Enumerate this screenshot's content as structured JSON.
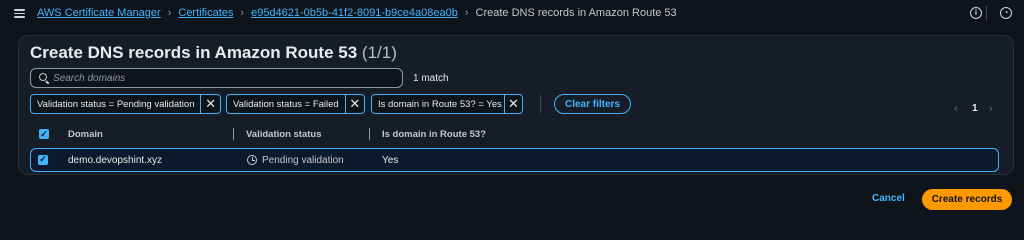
{
  "breadcrumbs": {
    "items": [
      "AWS Certificate Manager",
      "Certificates",
      "e95d4621-0b5b-41f2-8091-b9ce4a08ea0b"
    ],
    "current": "Create DNS records in Amazon Route 53"
  },
  "page": {
    "title": "Create DNS records in Amazon Route 53",
    "count": "(1/1)"
  },
  "search": {
    "placeholder": "Search domains",
    "value": "",
    "match_text": "1 match"
  },
  "filters": {
    "tokens": [
      "Validation status = Pending validation",
      "Validation status = Failed",
      "Is domain in Route 53? = Yes"
    ],
    "clear_label": "Clear filters"
  },
  "pagination": {
    "current_page": "1",
    "prev_icon": "chevron-left-icon",
    "next_icon": "chevron-right-icon"
  },
  "table": {
    "columns": [
      "Domain",
      "Validation status",
      "Is domain in Route 53?"
    ],
    "rows": [
      {
        "domain": "demo.devopshint.xyz",
        "status": "Pending validation",
        "in_route53": "Yes",
        "selected": true
      }
    ]
  },
  "actions": {
    "cancel_label": "Cancel",
    "submit_label": "Create records"
  },
  "colors": {
    "accent": "#42b4ff",
    "primary_button": "#ff9900",
    "background": "#0f141a",
    "panel": "#161d26"
  }
}
